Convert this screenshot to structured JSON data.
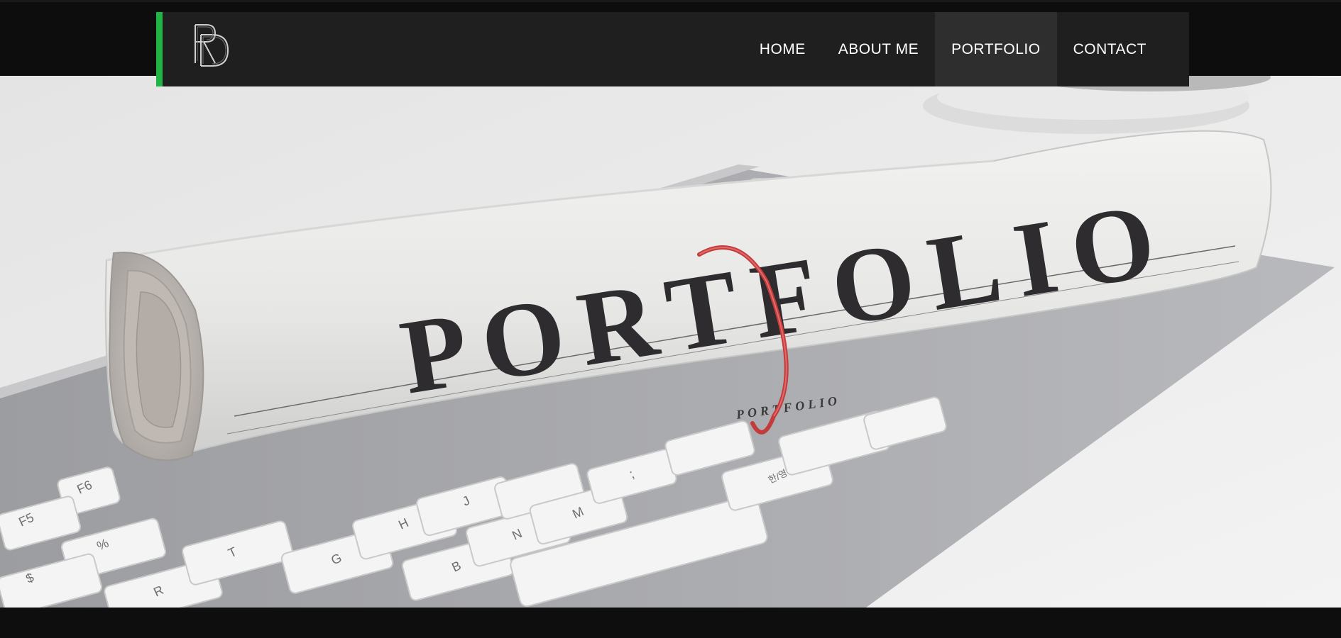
{
  "site": {
    "logo_alt": "RD monogram",
    "accent_color": "#1fb444"
  },
  "nav": {
    "items": [
      {
        "label": "HOME",
        "active": false
      },
      {
        "label": "ABOUT ME",
        "active": false
      },
      {
        "label": "PORTFOLIO",
        "active": true
      },
      {
        "label": "CONTACT",
        "active": false
      }
    ]
  },
  "hero": {
    "headline": "PORTFOLIO",
    "subline": "PORTFOLIO",
    "keys": {
      "f5": "F5",
      "f6": "F6",
      "k5": "%\n5",
      "k4": "$\n4",
      "r": "R",
      "t": "T",
      "g": "G",
      "h": "H",
      "j": "J",
      "b": "B",
      "n": "N",
      "m": "M",
      "semicolon": ";",
      "hangul": "한/영"
    }
  }
}
